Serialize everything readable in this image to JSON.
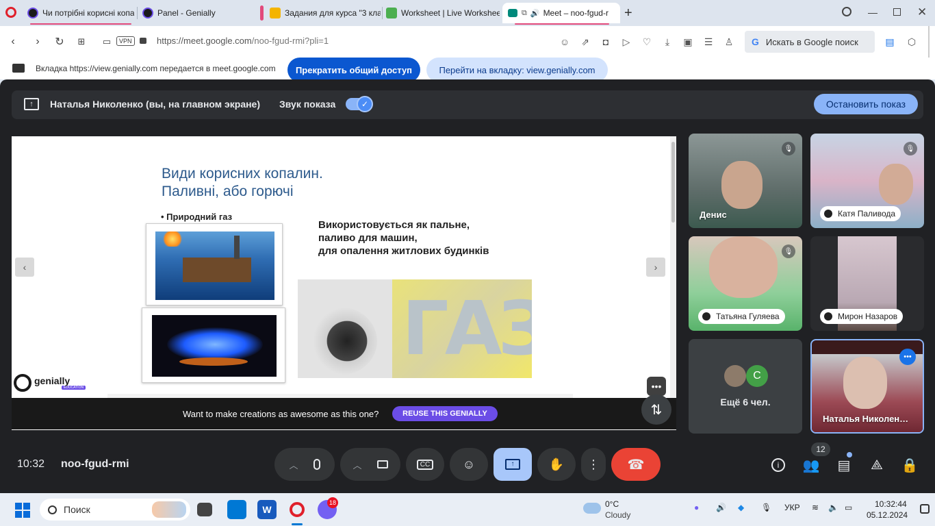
{
  "browser": {
    "tabs": [
      {
        "label": "Чи потрібні корисні копа",
        "active": false
      },
      {
        "label": "Panel - Genially",
        "active": false
      },
      {
        "label": "Задания для курса \"3 кла",
        "active": false
      },
      {
        "label": "Worksheet | Live Workshee",
        "active": false
      },
      {
        "label": "Meet – noo-fgud-r",
        "active": true
      }
    ],
    "new_tab": "+",
    "vpn_badge": "VPN",
    "url_base": "https://meet.google.com",
    "url_path": "/noo-fgud-rmi?pli=1",
    "search_placeholder": "Искать в Google поиск"
  },
  "share_banner": {
    "text": "Вкладка https://view.genially.com передается в meet.google.com",
    "stop_label": "Прекратить общий доступ",
    "goto_label": "Перейти на вкладку: view.genially.com"
  },
  "presenting": {
    "name": "Наталья Николенко (вы, на главном экране)",
    "sound_label": "Звук показа",
    "stop_label": "Остановить показ"
  },
  "slide": {
    "title_line1": "Види корисних копалин.",
    "title_line2": "Паливні, або горючі",
    "bullet": "• Природний газ",
    "desc_line1": "Використовується як пальне,",
    "desc_line2": "паливо для машин,",
    "desc_line3": "для опалення житлових будинків",
    "logo_text": "genially",
    "logo_sub": "EDUCATION",
    "poster_text": "ГАЗ",
    "prev": "‹",
    "next": "›",
    "reuse_text": "Want to make creations as awesome as this one?",
    "reuse_button": "REUSE THIS GENIALLY"
  },
  "participants": [
    {
      "name": "Денис",
      "muted": true
    },
    {
      "name": "Катя Паливода",
      "muted": true
    },
    {
      "name": "Татьяна Гуляева",
      "muted": true
    },
    {
      "name": "Мирон Назаров",
      "muted": false
    },
    {
      "name": "Ещё 6 чел.",
      "avatar_letter": "C"
    },
    {
      "name": "Наталья Николен…",
      "self": true
    }
  ],
  "controls": {
    "time": "10:32",
    "meeting_code": "noo-fgud-rmi",
    "participants_count": "12"
  },
  "taskbar": {
    "search_label": "Поиск",
    "viber_badge": "18",
    "weather_temp": "0°C",
    "weather_desc": "Cloudy",
    "lang": "УКР",
    "time": "10:32:44",
    "date": "05.12.2024"
  },
  "colors": {
    "meet_bg": "#202124",
    "accent_blue": "#0b57d0",
    "end_call_red": "#ea4335",
    "present_active": "#a8c7fa"
  }
}
